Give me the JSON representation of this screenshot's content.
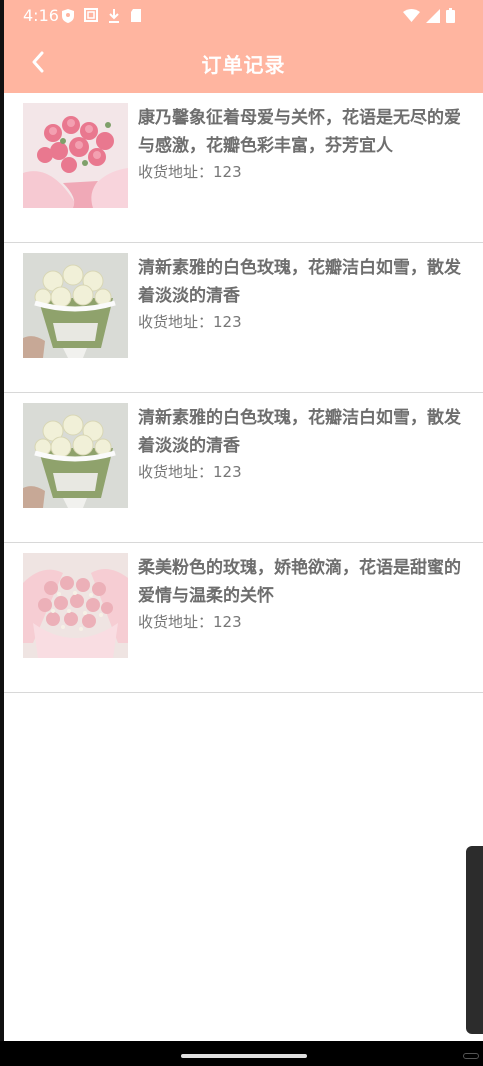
{
  "status_bar": {
    "time": "4:16",
    "icons_left": [
      "shield-icon",
      "screen-icon",
      "download-icon",
      "sd-card-icon"
    ],
    "icons_right": [
      "wifi-icon",
      "signal-icon",
      "battery-icon"
    ]
  },
  "header": {
    "title": "订单记录",
    "background": "#ffb5a0"
  },
  "orders": [
    {
      "title": "康乃馨象征着母爱与关怀，花语是无尽的爱与感激，花瓣色彩丰富，芬芳宜人",
      "address_label": "收货地址：",
      "address": "123",
      "image": "pink-carnation-bouquet"
    },
    {
      "title": "清新素雅的白色玫瑰，花瓣洁白如雪，散发着淡淡的清香",
      "address_label": "收货地址：",
      "address": "123",
      "image": "white-rose-bouquet"
    },
    {
      "title": "清新素雅的白色玫瑰，花瓣洁白如雪，散发着淡淡的清香",
      "address_label": "收货地址：",
      "address": "123",
      "image": "white-rose-bouquet"
    },
    {
      "title": "柔美粉色的玫瑰，娇艳欲滴，花语是甜蜜的爱情与温柔的关怀",
      "address_label": "收货地址：",
      "address": "123",
      "image": "pink-rose-bouquet"
    }
  ]
}
